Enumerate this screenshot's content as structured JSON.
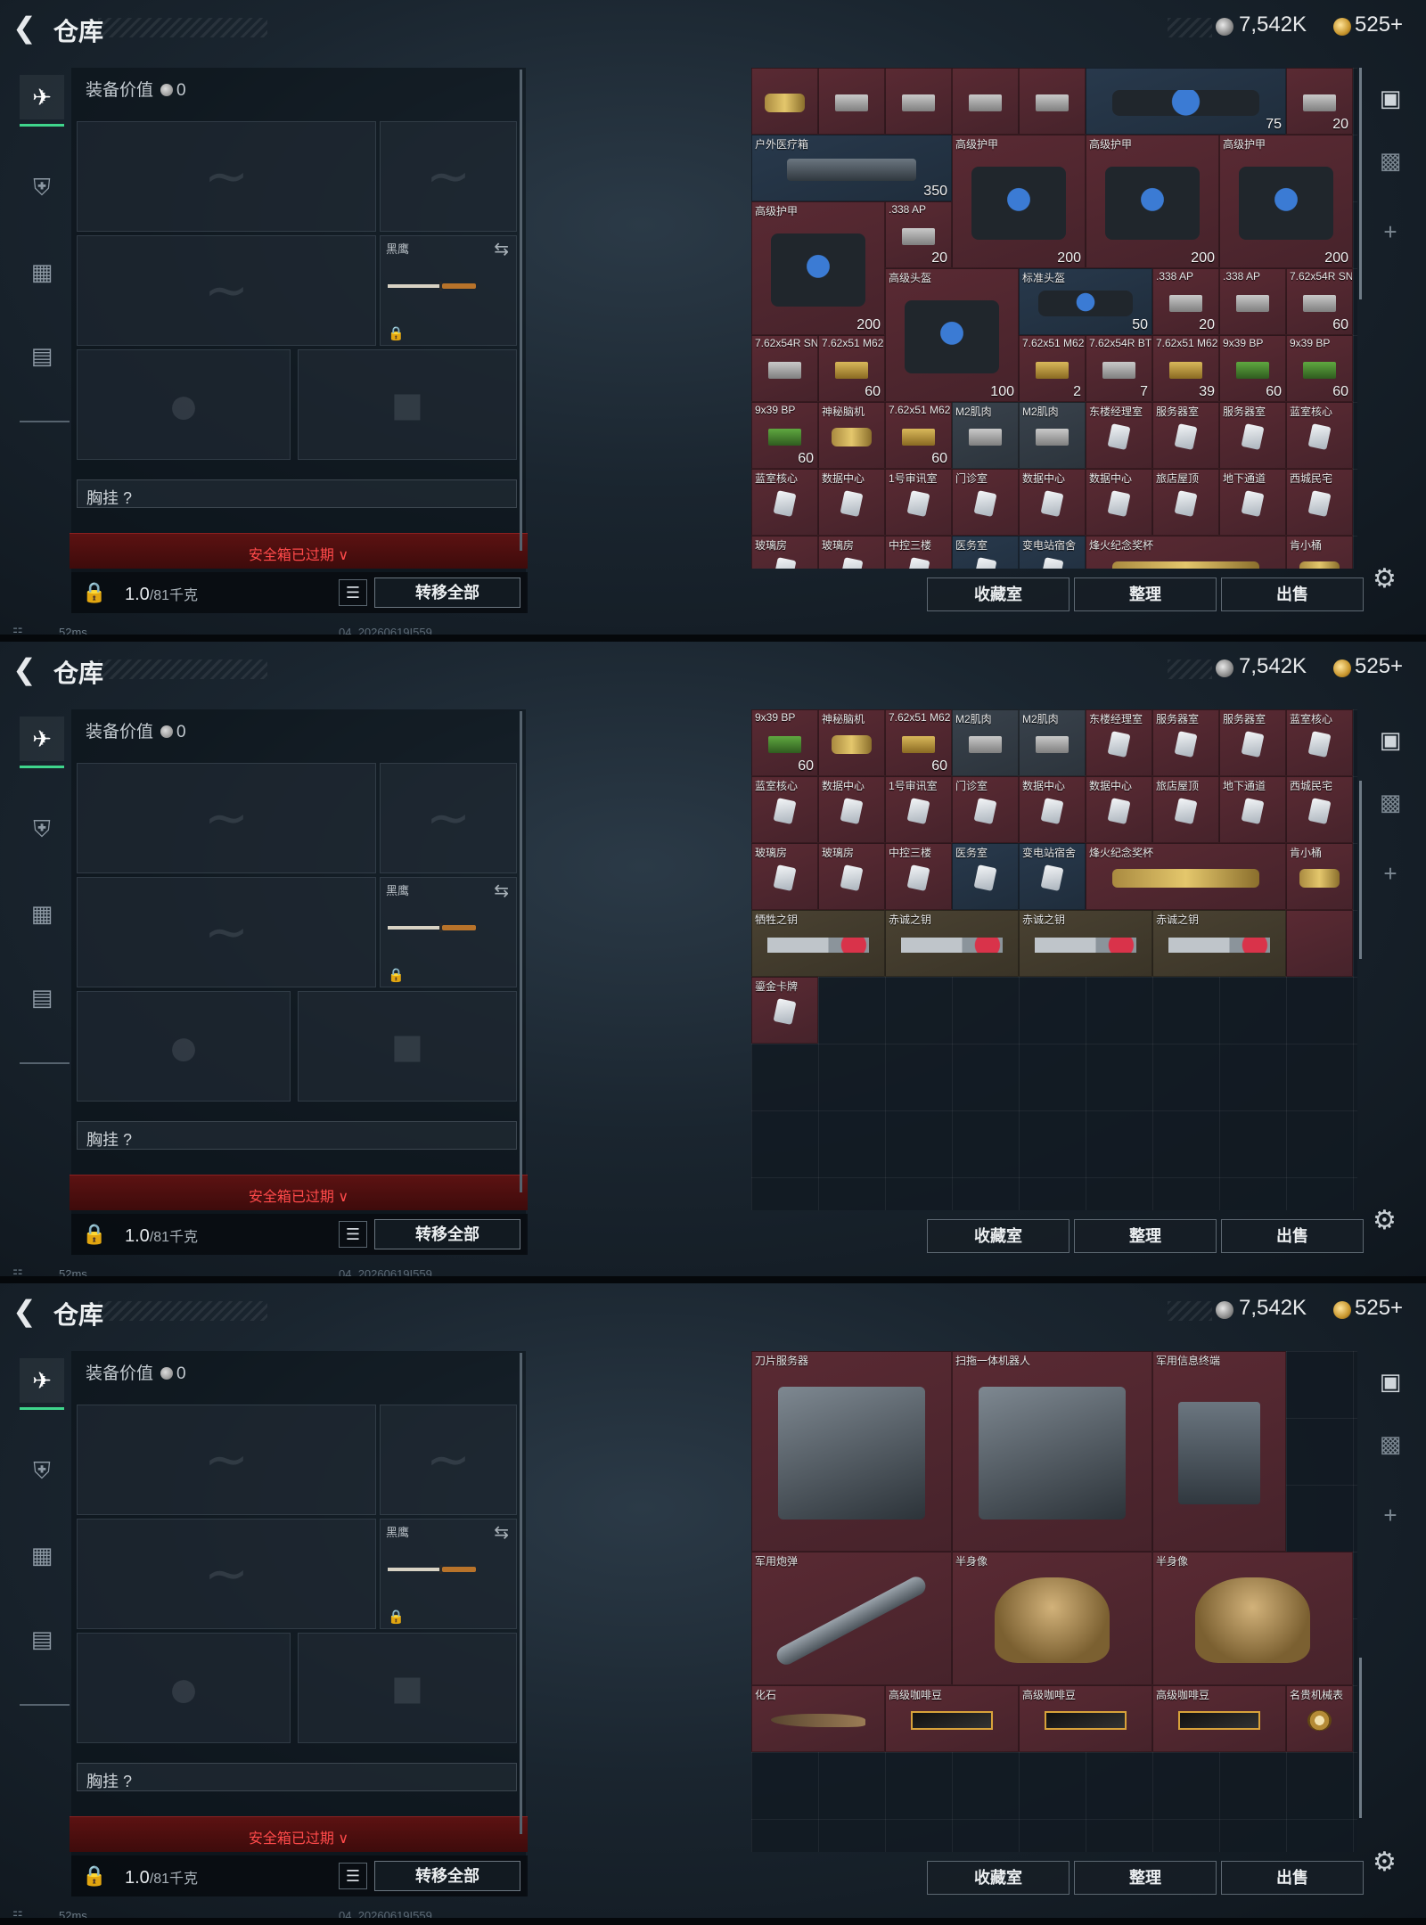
{
  "title": "仓库",
  "currency": {
    "silver": "7,542K",
    "gold": "525+"
  },
  "status": {
    "ping": "52ms",
    "build": "04_20260619I559"
  },
  "equipment": {
    "value_label": "装备价值",
    "value": "0",
    "melee_label": "黑鹰",
    "chest_rig": "胸挂",
    "chest_rig_help": "?",
    "safe_box": "安全箱已过期",
    "capacity_value": "1.0",
    "capacity_unit": "/81千克",
    "transfer_all": "转移全部"
  },
  "actions": {
    "collection": "收藏室",
    "sort": "整理",
    "sell": "出售"
  },
  "icons": {
    "back": "back-arrow-icon",
    "weapon": "pistol-icon",
    "armor": "armor-icon",
    "backpack": "backpack-icon",
    "case": "briefcase-icon",
    "safe": "safe-icon",
    "gallery": "gallery-icon",
    "add": "plus-icon",
    "settings": "gear-icon",
    "lock": "lock-icon",
    "list": "list-icon",
    "swap": "swap-icon"
  },
  "colors": {
    "accent_green": "#3fd58c",
    "alert_red": "#ff4a4a"
  },
  "panels": [
    {
      "items": [
        {
          "name": "",
          "count": "",
          "c": 0,
          "r": 0,
          "w": 1,
          "h": 1,
          "t": "red",
          "a": "gold"
        },
        {
          "name": "",
          "count": "",
          "c": 1,
          "r": 0,
          "w": 1,
          "h": 1,
          "t": "red",
          "a": "ammo"
        },
        {
          "name": "",
          "count": "",
          "c": 2,
          "r": 0,
          "w": 1,
          "h": 1,
          "t": "red",
          "a": "ammo"
        },
        {
          "name": "",
          "count": "",
          "c": 3,
          "r": 0,
          "w": 1,
          "h": 1,
          "t": "red",
          "a": "ammo"
        },
        {
          "name": "",
          "count": "",
          "c": 4,
          "r": 0,
          "w": 1,
          "h": 1,
          "t": "red",
          "a": "ammo"
        },
        {
          "name": "",
          "count": "75",
          "c": 5,
          "r": 0,
          "w": 3,
          "h": 1,
          "t": "blue",
          "a": "bag"
        },
        {
          "name": "",
          "count": "20",
          "c": 8,
          "r": 0,
          "w": 1,
          "h": 1,
          "t": "red",
          "a": "ammo"
        },
        {
          "name": "户外医疗箱",
          "count": "350",
          "c": 0,
          "r": 1,
          "w": 3,
          "h": 1,
          "t": "blue",
          "a": "box"
        },
        {
          "name": "高级护甲",
          "count": "200",
          "c": 3,
          "r": 1,
          "w": 2,
          "h": 2,
          "t": "red",
          "a": "bag"
        },
        {
          "name": "高级护甲",
          "count": "200",
          "c": 5,
          "r": 1,
          "w": 2,
          "h": 2,
          "t": "red",
          "a": "bag"
        },
        {
          "name": "高级护甲",
          "count": "200",
          "c": 7,
          "r": 1,
          "w": 2,
          "h": 2,
          "t": "red",
          "a": "bag"
        },
        {
          "name": "高级护甲",
          "count": "200",
          "c": 0,
          "r": 2,
          "w": 2,
          "h": 2,
          "t": "red",
          "a": "bag"
        },
        {
          "name": ".338 AP",
          "count": "20",
          "c": 2,
          "r": 2,
          "w": 1,
          "h": 1,
          "t": "red",
          "a": "ammo"
        },
        {
          "name": "高级头盔",
          "count": "100",
          "c": 2,
          "r": 3,
          "w": 2,
          "h": 2,
          "t": "red",
          "a": "bag"
        },
        {
          "name": "标准头盔",
          "count": "50",
          "c": 4,
          "r": 3,
          "w": 2,
          "h": 1,
          "t": "blue",
          "a": "bag"
        },
        {
          "name": ".338 AP",
          "count": "20",
          "c": 6,
          "r": 3,
          "w": 1,
          "h": 1,
          "t": "red",
          "a": "ammo"
        },
        {
          "name": ".338 AP",
          "count": "",
          "c": 7,
          "r": 3,
          "w": 1,
          "h": 1,
          "t": "red",
          "a": "ammo"
        },
        {
          "name": "7.62x54R SNB",
          "count": "60",
          "c": 8,
          "r": 3,
          "w": 1,
          "h": 1,
          "t": "red",
          "a": "ammo"
        },
        {
          "name": "7.62x54R SNB",
          "count": "",
          "c": 0,
          "r": 4,
          "w": 1,
          "h": 1,
          "t": "red",
          "a": "ammo"
        },
        {
          "name": "7.62x51 M62",
          "count": "60",
          "c": 1,
          "r": 4,
          "w": 1,
          "h": 1,
          "t": "red",
          "a": "ammoy"
        },
        {
          "name": "7.62x51 M62",
          "count": "2",
          "c": 4,
          "r": 4,
          "w": 1,
          "h": 1,
          "t": "red",
          "a": "ammoy"
        },
        {
          "name": "7.62x54R BT",
          "count": "7",
          "c": 5,
          "r": 4,
          "w": 1,
          "h": 1,
          "t": "red",
          "a": "ammo"
        },
        {
          "name": "7.62x51 M62",
          "count": "39",
          "c": 6,
          "r": 4,
          "w": 1,
          "h": 1,
          "t": "red",
          "a": "ammoy"
        },
        {
          "name": "9x39 BP",
          "count": "60",
          "c": 7,
          "r": 4,
          "w": 1,
          "h": 1,
          "t": "red",
          "a": "ammog"
        },
        {
          "name": "9x39 BP",
          "count": "60",
          "c": 8,
          "r": 4,
          "w": 1,
          "h": 1,
          "t": "red",
          "a": "ammog"
        },
        {
          "name": "9x39 BP",
          "count": "60",
          "c": 0,
          "r": 5,
          "w": 1,
          "h": 1,
          "t": "red",
          "a": "ammog"
        },
        {
          "name": "神秘脑机",
          "count": "",
          "c": 1,
          "r": 5,
          "w": 1,
          "h": 1,
          "t": "red",
          "a": "gold"
        },
        {
          "name": "7.62x51 M62",
          "count": "60",
          "c": 2,
          "r": 5,
          "w": 1,
          "h": 1,
          "t": "red",
          "a": "ammoy"
        },
        {
          "name": "M2肌肉",
          "count": "",
          "c": 3,
          "r": 5,
          "w": 1,
          "h": 1,
          "t": "grey",
          "a": "ammo"
        },
        {
          "name": "M2肌肉",
          "count": "",
          "c": 4,
          "r": 5,
          "w": 1,
          "h": 1,
          "t": "grey",
          "a": "ammo"
        },
        {
          "name": "东楼经理室",
          "count": "",
          "c": 5,
          "r": 5,
          "w": 1,
          "h": 1,
          "t": "red",
          "a": "card"
        },
        {
          "name": "服务器室",
          "count": "",
          "c": 6,
          "r": 5,
          "w": 1,
          "h": 1,
          "t": "red",
          "a": "card"
        },
        {
          "name": "服务器室",
          "count": "",
          "c": 7,
          "r": 5,
          "w": 1,
          "h": 1,
          "t": "red",
          "a": "card"
        },
        {
          "name": "蓝室核心",
          "count": "",
          "c": 8,
          "r": 5,
          "w": 1,
          "h": 1,
          "t": "red",
          "a": "card"
        },
        {
          "name": "蓝室核心",
          "count": "",
          "c": 0,
          "r": 6,
          "w": 1,
          "h": 1,
          "t": "red",
          "a": "card"
        },
        {
          "name": "数据中心",
          "count": "",
          "c": 1,
          "r": 6,
          "w": 1,
          "h": 1,
          "t": "red",
          "a": "card"
        },
        {
          "name": "1号审讯室",
          "count": "",
          "c": 2,
          "r": 6,
          "w": 1,
          "h": 1,
          "t": "red",
          "a": "card"
        },
        {
          "name": "门诊室",
          "count": "",
          "c": 3,
          "r": 6,
          "w": 1,
          "h": 1,
          "t": "red",
          "a": "card"
        },
        {
          "name": "数据中心",
          "count": "",
          "c": 4,
          "r": 6,
          "w": 1,
          "h": 1,
          "t": "red",
          "a": "card"
        },
        {
          "name": "数据中心",
          "count": "",
          "c": 5,
          "r": 6,
          "w": 1,
          "h": 1,
          "t": "red",
          "a": "card"
        },
        {
          "name": "旅店屋顶",
          "count": "",
          "c": 6,
          "r": 6,
          "w": 1,
          "h": 1,
          "t": "red",
          "a": "card"
        },
        {
          "name": "地下通道",
          "count": "",
          "c": 7,
          "r": 6,
          "w": 1,
          "h": 1,
          "t": "red",
          "a": "card"
        },
        {
          "name": "西城民宅",
          "count": "",
          "c": 8,
          "r": 6,
          "w": 1,
          "h": 1,
          "t": "red",
          "a": "card"
        },
        {
          "name": "玻璃房",
          "count": "",
          "c": 0,
          "r": 7,
          "w": 1,
          "h": 1,
          "t": "red",
          "a": "card"
        },
        {
          "name": "玻璃房",
          "count": "",
          "c": 1,
          "r": 7,
          "w": 1,
          "h": 1,
          "t": "red",
          "a": "card"
        },
        {
          "name": "中控三楼",
          "count": "",
          "c": 2,
          "r": 7,
          "w": 1,
          "h": 1,
          "t": "red",
          "a": "card"
        },
        {
          "name": "医务室",
          "count": "",
          "c": 3,
          "r": 7,
          "w": 1,
          "h": 1,
          "t": "blue",
          "a": "card"
        },
        {
          "name": "变电站宿舍",
          "count": "",
          "c": 4,
          "r": 7,
          "w": 1,
          "h": 1,
          "t": "blue",
          "a": "card"
        },
        {
          "name": "烽火纪念奖杯",
          "count": "",
          "c": 5,
          "r": 7,
          "w": 3,
          "h": 1,
          "t": "red",
          "a": "gold"
        },
        {
          "name": "肯小桶",
          "count": "",
          "c": 8,
          "r": 7,
          "w": 1,
          "h": 1,
          "t": "red",
          "a": "gold"
        }
      ]
    },
    {
      "items": [
        {
          "name": "9x39 BP",
          "count": "60",
          "c": 0,
          "r": 0,
          "w": 1,
          "h": 1,
          "t": "red",
          "a": "ammog"
        },
        {
          "name": "神秘脑机",
          "count": "",
          "c": 1,
          "r": 0,
          "w": 1,
          "h": 1,
          "t": "red",
          "a": "gold"
        },
        {
          "name": "7.62x51 M62",
          "count": "60",
          "c": 2,
          "r": 0,
          "w": 1,
          "h": 1,
          "t": "red",
          "a": "ammoy"
        },
        {
          "name": "M2肌肉",
          "count": "",
          "c": 3,
          "r": 0,
          "w": 1,
          "h": 1,
          "t": "grey",
          "a": "ammo"
        },
        {
          "name": "M2肌肉",
          "count": "",
          "c": 4,
          "r": 0,
          "w": 1,
          "h": 1,
          "t": "grey",
          "a": "ammo"
        },
        {
          "name": "东楼经理室",
          "count": "",
          "c": 5,
          "r": 0,
          "w": 1,
          "h": 1,
          "t": "red",
          "a": "card"
        },
        {
          "name": "服务器室",
          "count": "",
          "c": 6,
          "r": 0,
          "w": 1,
          "h": 1,
          "t": "red",
          "a": "card"
        },
        {
          "name": "服务器室",
          "count": "",
          "c": 7,
          "r": 0,
          "w": 1,
          "h": 1,
          "t": "red",
          "a": "card"
        },
        {
          "name": "蓝室核心",
          "count": "",
          "c": 8,
          "r": 0,
          "w": 1,
          "h": 1,
          "t": "red",
          "a": "card"
        },
        {
          "name": "蓝室核心",
          "count": "",
          "c": 0,
          "r": 1,
          "w": 1,
          "h": 1,
          "t": "red",
          "a": "card"
        },
        {
          "name": "数据中心",
          "count": "",
          "c": 1,
          "r": 1,
          "w": 1,
          "h": 1,
          "t": "red",
          "a": "card"
        },
        {
          "name": "1号审讯室",
          "count": "",
          "c": 2,
          "r": 1,
          "w": 1,
          "h": 1,
          "t": "red",
          "a": "card"
        },
        {
          "name": "门诊室",
          "count": "",
          "c": 3,
          "r": 1,
          "w": 1,
          "h": 1,
          "t": "red",
          "a": "card"
        },
        {
          "name": "数据中心",
          "count": "",
          "c": 4,
          "r": 1,
          "w": 1,
          "h": 1,
          "t": "red",
          "a": "card"
        },
        {
          "name": "数据中心",
          "count": "",
          "c": 5,
          "r": 1,
          "w": 1,
          "h": 1,
          "t": "red",
          "a": "card"
        },
        {
          "name": "旅店屋顶",
          "count": "",
          "c": 6,
          "r": 1,
          "w": 1,
          "h": 1,
          "t": "red",
          "a": "card"
        },
        {
          "name": "地下通道",
          "count": "",
          "c": 7,
          "r": 1,
          "w": 1,
          "h": 1,
          "t": "red",
          "a": "card"
        },
        {
          "name": "西城民宅",
          "count": "",
          "c": 8,
          "r": 1,
          "w": 1,
          "h": 1,
          "t": "red",
          "a": "card"
        },
        {
          "name": "玻璃房",
          "count": "",
          "c": 0,
          "r": 2,
          "w": 1,
          "h": 1,
          "t": "red",
          "a": "card"
        },
        {
          "name": "玻璃房",
          "count": "",
          "c": 1,
          "r": 2,
          "w": 1,
          "h": 1,
          "t": "red",
          "a": "card"
        },
        {
          "name": "中控三楼",
          "count": "",
          "c": 2,
          "r": 2,
          "w": 1,
          "h": 1,
          "t": "red",
          "a": "card"
        },
        {
          "name": "医务室",
          "count": "",
          "c": 3,
          "r": 2,
          "w": 1,
          "h": 1,
          "t": "blue",
          "a": "card"
        },
        {
          "name": "变电站宿舍",
          "count": "",
          "c": 4,
          "r": 2,
          "w": 1,
          "h": 1,
          "t": "blue",
          "a": "card"
        },
        {
          "name": "烽火纪念奖杯",
          "count": "",
          "c": 5,
          "r": 2,
          "w": 3,
          "h": 1,
          "t": "red",
          "a": "gold"
        },
        {
          "name": "肯小桶",
          "count": "",
          "c": 8,
          "r": 2,
          "w": 1,
          "h": 1,
          "t": "red",
          "a": "gold"
        },
        {
          "name": "牺牲之钥",
          "count": "",
          "c": 0,
          "r": 3,
          "w": 2,
          "h": 1,
          "t": "gold",
          "a": "key"
        },
        {
          "name": "赤诚之钥",
          "count": "",
          "c": 2,
          "r": 3,
          "w": 2,
          "h": 1,
          "t": "gold",
          "a": "key"
        },
        {
          "name": "赤诚之钥",
          "count": "",
          "c": 4,
          "r": 3,
          "w": 2,
          "h": 1,
          "t": "gold",
          "a": "key"
        },
        {
          "name": "赤诚之钥",
          "count": "",
          "c": 6,
          "r": 3,
          "w": 2,
          "h": 1,
          "t": "gold",
          "a": "key"
        },
        {
          "name": "",
          "count": "",
          "c": 8,
          "r": 3,
          "w": 1,
          "h": 1,
          "t": "red",
          "a": "none"
        },
        {
          "name": "鎏金卡牌",
          "count": "",
          "c": 0,
          "r": 4,
          "w": 1,
          "h": 1,
          "t": "red",
          "a": "card"
        }
      ]
    },
    {
      "items": [
        {
          "name": "刀片服务器",
          "count": "",
          "c": 0,
          "r": 0,
          "w": 3,
          "h": 3,
          "t": "red",
          "a": "big"
        },
        {
          "name": "扫拖一体机器人",
          "count": "",
          "c": 3,
          "r": 0,
          "w": 3,
          "h": 3,
          "t": "red",
          "a": "big"
        },
        {
          "name": "军用信息终端",
          "count": "",
          "c": 6,
          "r": 0,
          "w": 2,
          "h": 3,
          "t": "red",
          "a": "box"
        },
        {
          "name": "军用炮弹",
          "count": "",
          "c": 0,
          "r": 3,
          "w": 3,
          "h": 2,
          "t": "red",
          "a": "missile"
        },
        {
          "name": "半身像",
          "count": "",
          "c": 3,
          "r": 3,
          "w": 3,
          "h": 2,
          "t": "red",
          "a": "bust"
        },
        {
          "name": "半身像",
          "count": "",
          "c": 6,
          "r": 3,
          "w": 3,
          "h": 2,
          "t": "red",
          "a": "bust"
        },
        {
          "name": "化石",
          "count": "",
          "c": 0,
          "r": 5,
          "w": 2,
          "h": 1,
          "t": "red",
          "a": "fossil"
        },
        {
          "name": "高级咖啡豆",
          "count": "",
          "c": 2,
          "r": 5,
          "w": 2,
          "h": 1,
          "t": "red",
          "a": "coffee"
        },
        {
          "name": "高级咖啡豆",
          "count": "",
          "c": 4,
          "r": 5,
          "w": 2,
          "h": 1,
          "t": "red",
          "a": "coffee"
        },
        {
          "name": "高级咖啡豆",
          "count": "",
          "c": 6,
          "r": 5,
          "w": 2,
          "h": 1,
          "t": "red",
          "a": "coffee"
        },
        {
          "name": "名贵机械表",
          "count": "",
          "c": 8,
          "r": 5,
          "w": 1,
          "h": 1,
          "t": "red",
          "a": "watch"
        }
      ]
    }
  ]
}
